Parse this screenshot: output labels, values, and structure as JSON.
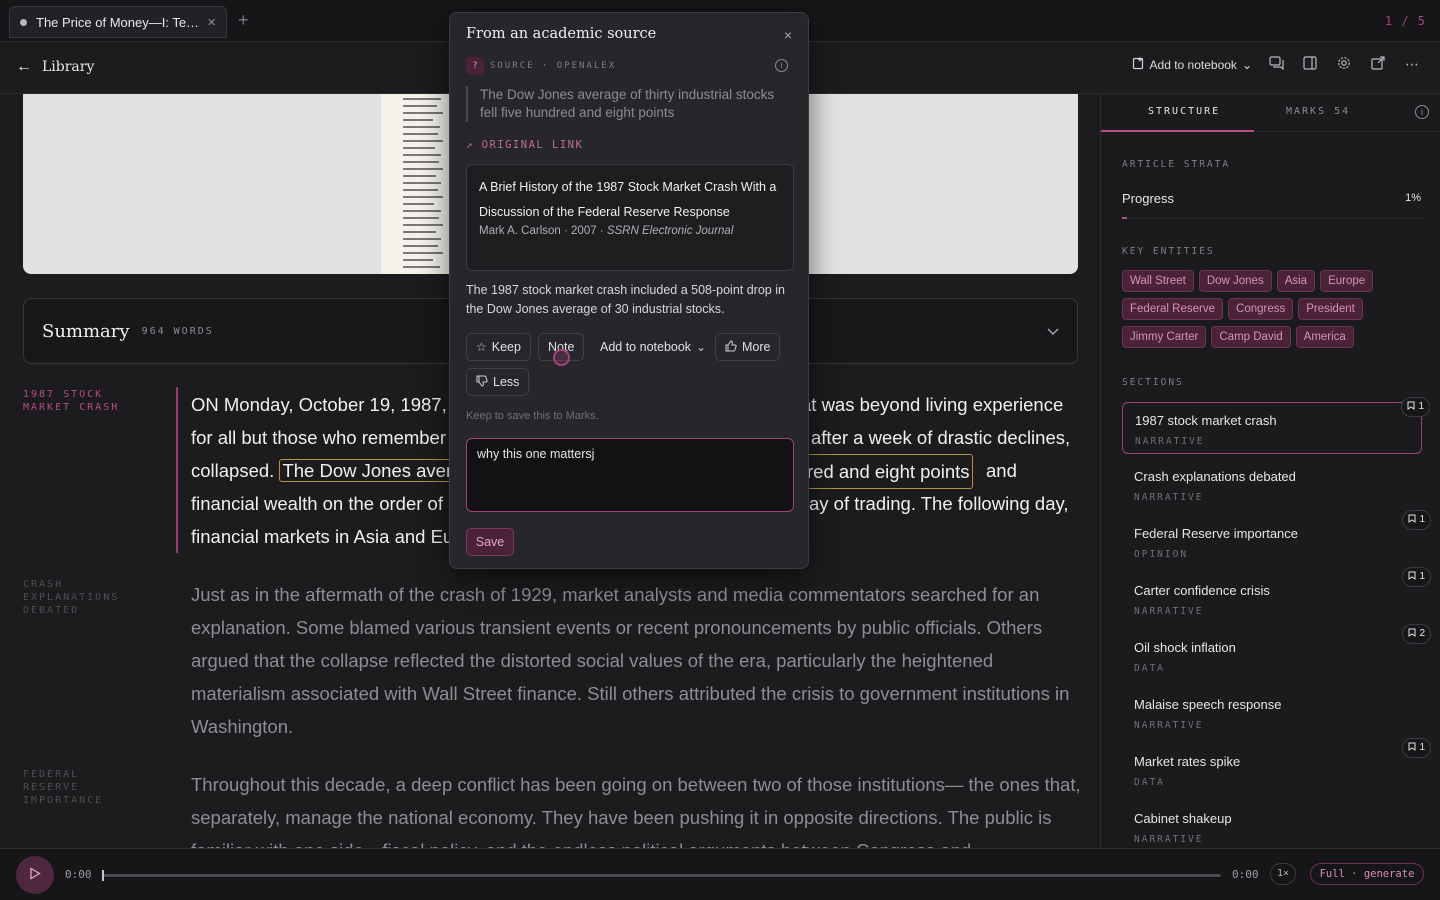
{
  "tabbar": {
    "tab_title": "The Price of Money—I: Te…",
    "close_glyph": "×",
    "add_glyph": "+",
    "page_counter": "1 / 5"
  },
  "header": {
    "back_label": "Library",
    "add_to_notebook": "Add to notebook"
  },
  "summary": {
    "title": "Summary",
    "word_count": "964 WORDS"
  },
  "sections_inline": [
    {
      "label": "1987 STOCK\nMARKET CRASH"
    },
    {
      "label": "CRASH\nEXPLANATIONS\nDEBATED"
    },
    {
      "label": "FEDERAL\nRESERVE\nIMPORTANCE"
    }
  ],
  "article": {
    "p1_before": "ON Monday, October 19, 1987,",
    "p1_mid_a": "at was beyond living experience",
    "p1_line2_a": "for all but those who remember",
    "p1_line2_b": "after a week of drastic declines,",
    "p1_line3_a": "collapsed.",
    "p1_hl_a": "The Dow Jones aver",
    "p1_hl_b": "red and eight points",
    "p1_line3_b": "and",
    "p1_line4_a": "financial wealth on the order of",
    "p1_line4_b": "ay of trading. The following day,",
    "p1_line5": "financial markets in Asia and Eu",
    "p2": "Just as in the aftermath of the crash of 1929, market analysts and media commentators searched for an explanation. Some blamed various transient events or recent pronouncements by public officials. Others argued that the collapse reflected the distorted social values of the era, particularly the heightened materialism associated with Wall Street finance. Still others attributed the crisis to government institutions in Washington.",
    "p3": "Throughout this decade, a deep conflict has been going on between two of those institutions— the ones that, separately, manage the national economy. They have been pushing it in opposite directions. The public is familiar with one side—fiscal policy, and the endless political arguments between Congress and"
  },
  "popover": {
    "title": "From an academic source",
    "close_glyph": "×",
    "source_badge": "?",
    "source_label": "SOURCE · OPENALEX",
    "quote": "The Dow Jones average of thirty industrial stocks fell five hundred and eight points",
    "original_link": "↗ ORIGINAL LINK",
    "citation_title": "A Brief History of the 1987 Stock Market Crash With a Discussion of the Federal Reserve Response",
    "citation_meta_prefix": "Mark A. Carlson · 2007 · ",
    "citation_journal": "SSRN Electronic Journal",
    "body": "The 1987 stock market crash included a 508-point drop in the Dow Jones average of 30 industrial stocks.",
    "keep_label": "Keep",
    "note_label": "Note",
    "add_notebook_label": "Add to notebook",
    "more_label": "More",
    "less_label": "Less",
    "hint": "Keep to save this to Marks.",
    "note_value": "why this one mattersj",
    "save_label": "Save"
  },
  "right_panel": {
    "tab_structure": "STRUCTURE",
    "tab_marks": "MARKS  54",
    "strata_label": "ARTICLE STRATA",
    "progress_label": "Progress",
    "progress_value": "1%",
    "progress_fraction": 0.01,
    "entities_label": "KEY ENTITIES",
    "entities": [
      "Wall Street",
      "Dow Jones",
      "Asia",
      "Europe",
      "Federal Reserve",
      "Congress",
      "President",
      "Jimmy Carter",
      "Camp David",
      "America"
    ],
    "sections_label": "SECTIONS",
    "sections": [
      {
        "name": "1987 stock market crash",
        "kind": "NARRATIVE",
        "marks": "1"
      },
      {
        "name": "Crash explanations debated",
        "kind": "NARRATIVE",
        "marks": ""
      },
      {
        "name": "Federal Reserve importance",
        "kind": "OPINION",
        "marks": "1"
      },
      {
        "name": "Carter confidence crisis",
        "kind": "NARRATIVE",
        "marks": "1"
      },
      {
        "name": "Oil shock inflation",
        "kind": "DATA",
        "marks": "2"
      },
      {
        "name": "Malaise speech response",
        "kind": "NARRATIVE",
        "marks": ""
      },
      {
        "name": "Market rates spike",
        "kind": "DATA",
        "marks": "1"
      },
      {
        "name": "Cabinet shakeup",
        "kind": "NARRATIVE",
        "marks": ""
      }
    ]
  },
  "player": {
    "time_start": "0:00",
    "time_end": "0:00",
    "rate": "1×",
    "generate_label": "Full · generate",
    "position_fraction": 0
  },
  "colors": {
    "accent": "#b44c86",
    "highlight": "#b4933e"
  }
}
